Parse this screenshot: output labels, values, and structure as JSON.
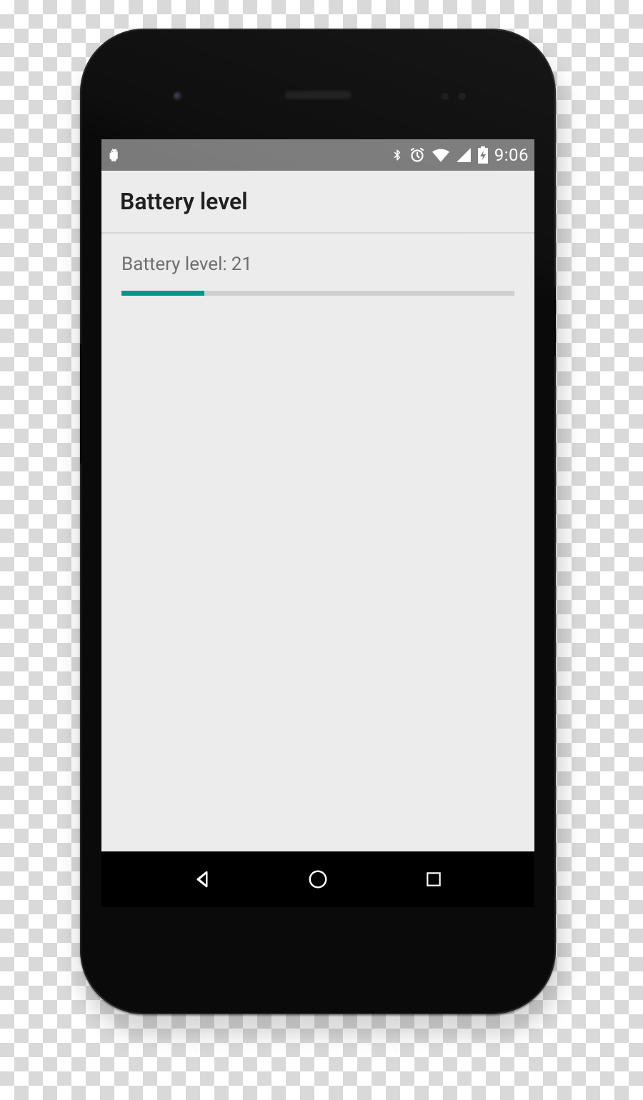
{
  "statusbar": {
    "clock": "9:06",
    "icons": {
      "debug": "android-debug-icon",
      "bluetooth": "bluetooth-icon",
      "alarm": "alarm-icon",
      "wifi": "wifi-icon",
      "cell": "cell-signal-icon",
      "battery": "battery-charging-icon"
    }
  },
  "appbar": {
    "title": "Battery level"
  },
  "content": {
    "battery_label": "Battery level:",
    "battery_value": "21",
    "progress_percent": 21
  },
  "colors": {
    "accent": "#009688",
    "statusbar_bg": "#7a7a7a",
    "screen_bg": "#ECECEC"
  }
}
